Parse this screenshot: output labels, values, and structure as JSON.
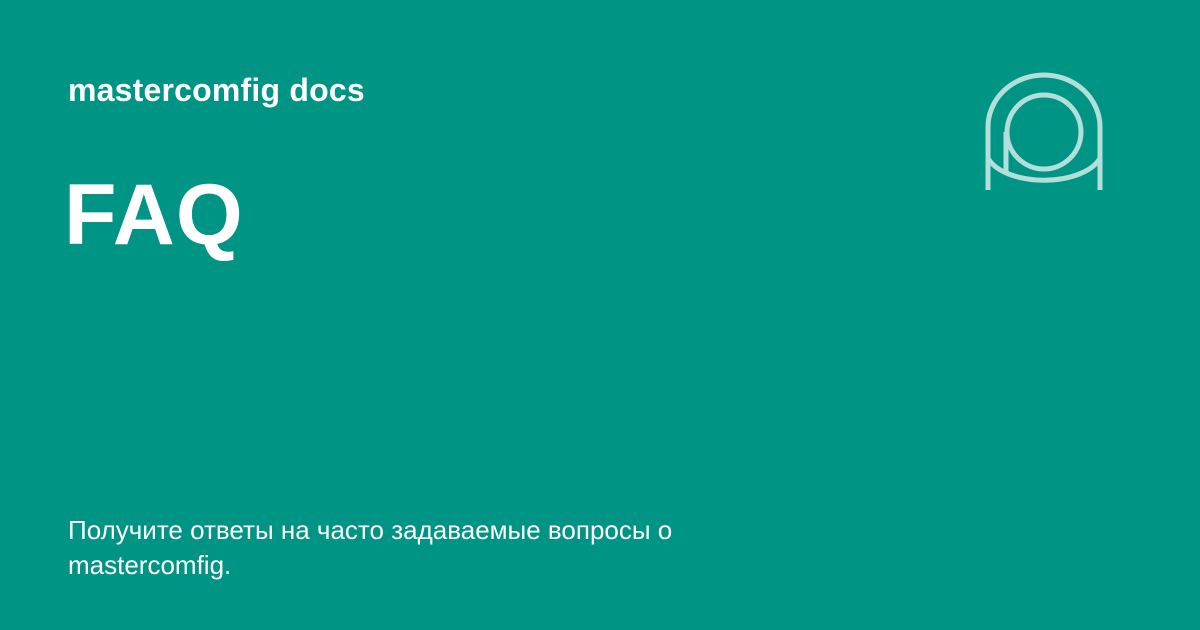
{
  "header": {
    "site_name": "mastercomfig docs"
  },
  "main": {
    "title": "FAQ",
    "description": "Получите ответы на часто задаваемые вопросы о mastercomfig."
  },
  "logo": {
    "icon": "mastercomfig-logo-icon",
    "color": "#b2dfd9"
  },
  "colors": {
    "background": "#009485",
    "text": "#ffffff"
  }
}
